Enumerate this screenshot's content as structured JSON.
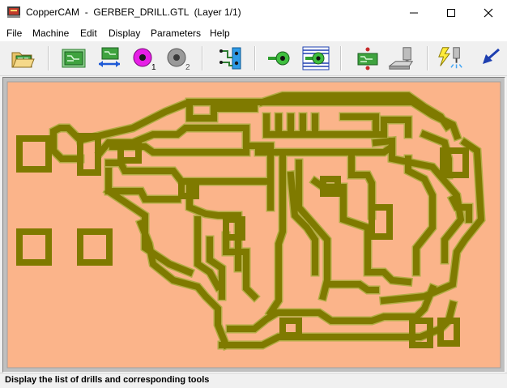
{
  "window": {
    "title": "CopperCAM  -  GERBER_DRILL.GTL  (Layer 1/1)"
  },
  "menu": [
    "File",
    "Machine",
    "Edit",
    "Display",
    "Parameters",
    "Help"
  ],
  "toolbar": {
    "icons": [
      "open-folder-icon",
      "board-green-icon",
      "board-swap-icon",
      "drill-1-icon",
      "drill-2-icon",
      "drill-list-icon",
      "contour-icon",
      "contour-multi-icon",
      "board-drill-icon",
      "mill-machine-icon",
      "lightning-tool-icon",
      "back-arrow-icon"
    ],
    "drill1_label": "1",
    "drill2_label": "2"
  },
  "colors": {
    "board": "#fbb48a",
    "trace": "#7f7a00",
    "trace_outline": "#b2ad45"
  },
  "status": {
    "text": "Display the list of drills and corresponding tools"
  }
}
